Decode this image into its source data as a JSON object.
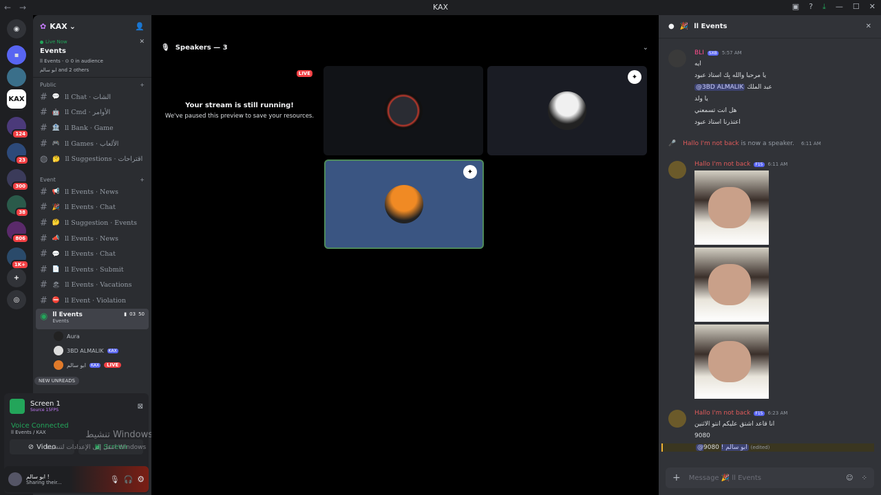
{
  "window": {
    "title": "KAX"
  },
  "server": {
    "name": "KAX",
    "live_label": "Live Now",
    "event_title": "Events",
    "event_meta": "ll Events · ⊙ 0 in audience",
    "event_people": "ابو سالم and 2 others"
  },
  "rail": {
    "badges": [
      "124",
      "23",
      "300",
      "38",
      "806",
      "1K+"
    ]
  },
  "categories": [
    {
      "name": "Public",
      "channels": [
        {
          "emoji": "💬",
          "name": "ll Chat · الشات"
        },
        {
          "emoji": "🤖",
          "name": "ll Cmd · الأوامر"
        },
        {
          "emoji": "🏦",
          "name": "ll Bank · Game"
        },
        {
          "emoji": "🎮",
          "name": "ll Games · الألعاب"
        },
        {
          "emoji": "🤔",
          "name": "ll Suggestions · اقتراحات"
        }
      ]
    },
    {
      "name": "Event",
      "channels": [
        {
          "emoji": "📢",
          "name": "ll Events · News"
        },
        {
          "emoji": "🎉",
          "name": "ll Events · Chat"
        },
        {
          "emoji": "🤔",
          "name": "ll Suggestion · Events"
        },
        {
          "emoji": "📣",
          "name": "ll Events · News"
        },
        {
          "emoji": "💬",
          "name": "ll Events · Chat"
        },
        {
          "emoji": "📄",
          "name": "ll Events · Submit"
        },
        {
          "emoji": "🏖",
          "name": "ll Events · Vacations"
        },
        {
          "emoji": "⛔",
          "name": "ll Event · Violation"
        }
      ]
    }
  ],
  "voice_channel": {
    "name": "ll Events",
    "sub": "Events",
    "cam": "03",
    "count": "50",
    "users": [
      {
        "name": "Aura",
        "tag": ""
      },
      {
        "name": "3BD ALMALIK",
        "tag": "KAX"
      },
      {
        "name": "ابو سالم",
        "tag": "KAX",
        "live": "LIVE"
      }
    ],
    "new_unreads": "NEW UNREADS"
  },
  "panel": {
    "screen": "Screen 1",
    "source": "Source 15FPS",
    "voice": "Voice Connected",
    "voice_sub": "ll Events / KAX",
    "video": "Video",
    "screen_btn": "Screen"
  },
  "user": {
    "name": "ابو سالم !",
    "status": "Sharing their..."
  },
  "watermark": {
    "line1": "تنشيط Windows",
    "line2": "انتقل إلى الإعدادات لتنشيط Windows"
  },
  "stage": {
    "speakers": "Speakers — 3",
    "live": "LIVE",
    "paused_title": "Your stream is still running!",
    "paused_sub": "We've paused this preview to save your resources."
  },
  "chat": {
    "header": "ll Events",
    "m1": {
      "name": "BLI",
      "tag": "SXB",
      "time": "5:57 AM",
      "lines": [
        "ايه",
        "يا مرحبا والله بِك استاذ عبود",
        "عبد الملك",
        "يا ولد",
        "هل انت تسمعني",
        "اعتذرنا استاذ عبود"
      ],
      "mention": "@3BD ALMALIK"
    },
    "system": {
      "name": "Hallo I'm not back",
      "text": "is now a speaker.",
      "time": "6:11 AM"
    },
    "m2": {
      "name": "Hallo I'm not back",
      "tag": "F15",
      "time": "6:11 AM"
    },
    "m3": {
      "name": "Hallo I'm not back",
      "tag": "F15",
      "time": "6:23 AM",
      "lines": [
        "انا قاعد اشتق عليكم انتو الاثنين",
        "9080"
      ],
      "reply": "@ابو سالم !",
      "reply_text": "9080",
      "edited": "(edited)"
    },
    "placeholder": "Message 🎉 ll Events"
  }
}
